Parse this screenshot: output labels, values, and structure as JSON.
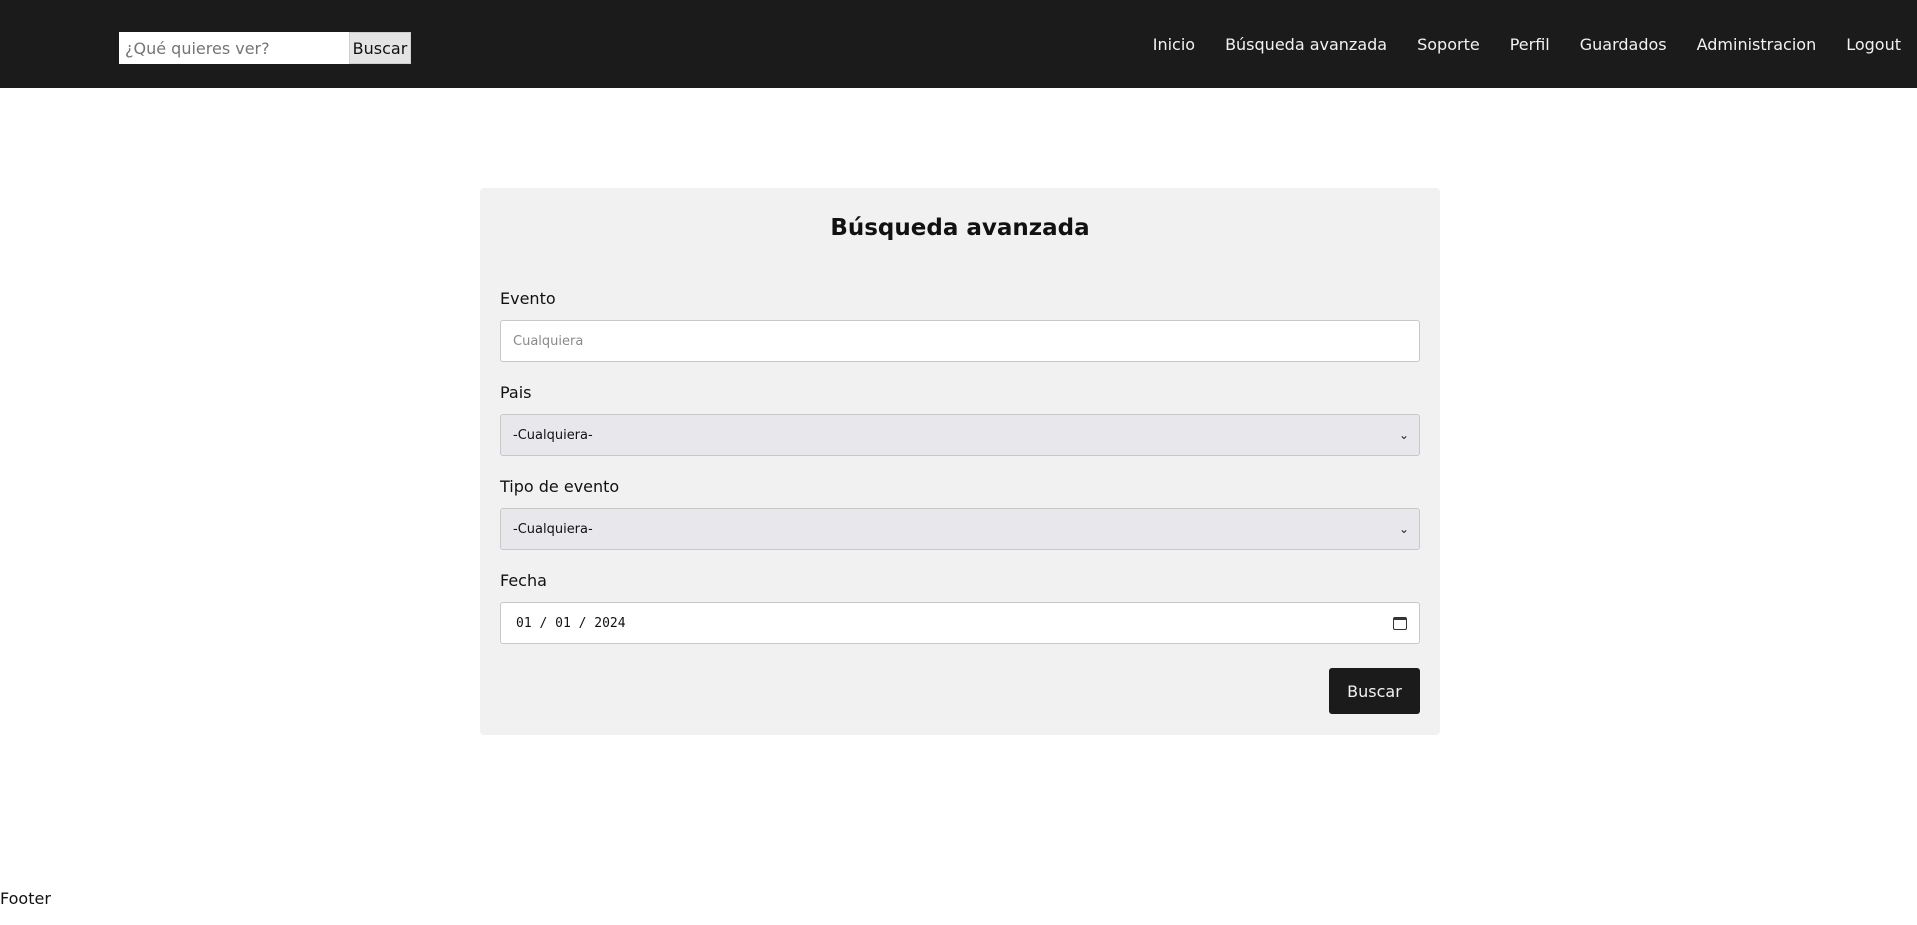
{
  "header": {
    "search_placeholder": "¿Qué quieres ver?",
    "search_button": "Buscar",
    "nav": [
      "Inicio",
      "Búsqueda avanzada",
      "Soporte",
      "Perfil",
      "Guardados",
      "Administracion",
      "Logout"
    ]
  },
  "form": {
    "title": "Búsqueda avanzada",
    "evento_label": "Evento",
    "evento_placeholder": "Cualquiera",
    "pais_label": "Pais",
    "pais_value": "-Cualquiera-",
    "tipo_label": "Tipo de evento",
    "tipo_value": "-Cualquiera-",
    "fecha_label": "Fecha",
    "fecha_value": "01 / 01 / 2024",
    "submit": "Buscar"
  },
  "footer": {
    "text": "Footer"
  },
  "colors": {
    "navbar": "#1b1b1b",
    "card": "#f1f1f1",
    "button": "#1b1b1b"
  },
  "icons": {
    "select_chevron": "chevron-down-icon",
    "date_picker": "calendar-icon"
  }
}
